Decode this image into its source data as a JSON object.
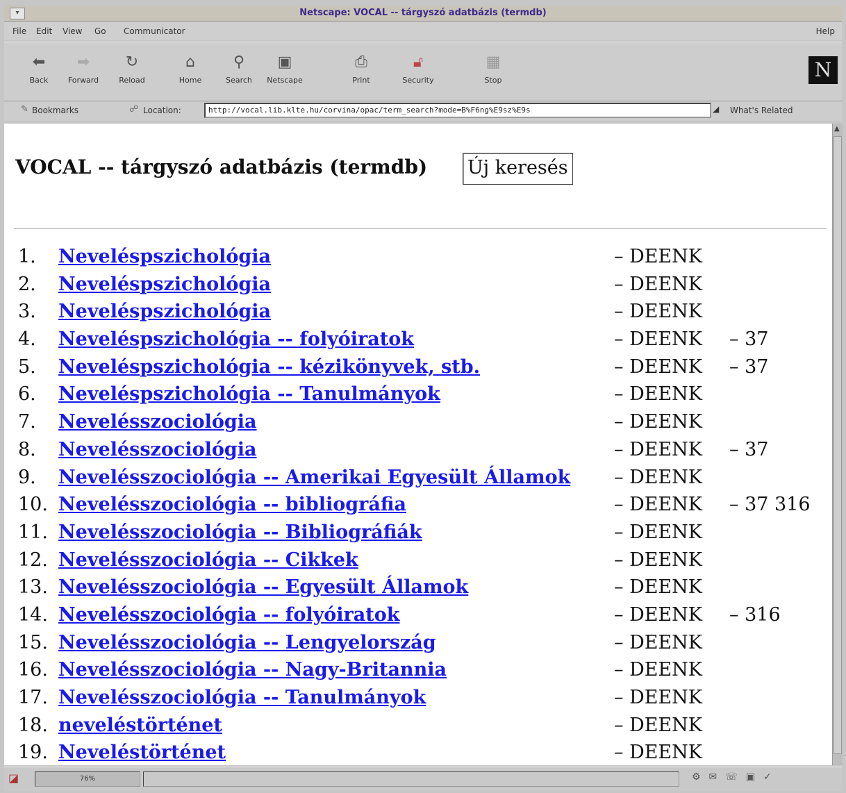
{
  "window": {
    "title": "Netscape: VOCAL -- tárgyszó adatbázis (termdb)"
  },
  "menu": {
    "items": [
      "File",
      "Edit",
      "View",
      "Go",
      "Communicator"
    ],
    "help": "Help"
  },
  "toolbar": {
    "buttons": [
      {
        "label": "Back",
        "icon": "back-arrow-icon"
      },
      {
        "label": "Forward",
        "icon": "forward-arrow-icon"
      },
      {
        "label": "Reload",
        "icon": "reload-icon"
      },
      {
        "label": "Home",
        "icon": "home-icon"
      },
      {
        "label": "Search",
        "icon": "search-icon"
      },
      {
        "label": "Netscape",
        "icon": "netscape-icon"
      },
      {
        "label": "Print",
        "icon": "print-icon"
      },
      {
        "label": "Security",
        "icon": "lock-icon"
      },
      {
        "label": "Stop",
        "icon": "stop-icon"
      }
    ],
    "logo": "N"
  },
  "location": {
    "bookmarks_label": "Bookmarks",
    "location_label": "Location:",
    "url": "http://vocal.lib.klte.hu/corvina/opac/term_search?mode=B%F6ng%E9sz%E9s",
    "related_label": "What's Related"
  },
  "page": {
    "title": "VOCAL -- tárgyszó adatbázis (termdb)",
    "new_search_button": "Új keresés"
  },
  "results": [
    {
      "num": "1.",
      "term": "Neveléspszichológia",
      "lib": "– DEENK",
      "code": ""
    },
    {
      "num": "2.",
      "term": "Neveléspszichológia",
      "lib": "– DEENK",
      "code": ""
    },
    {
      "num": "3.",
      "term": "Neveléspszichológia",
      "lib": "– DEENK",
      "code": ""
    },
    {
      "num": "4.",
      "term": "Neveléspszichológia -- folyóiratok",
      "lib": "– DEENK",
      "code": "– 37"
    },
    {
      "num": "5.",
      "term": "Neveléspszichológia -- kézikönyvek, stb.",
      "lib": "– DEENK",
      "code": "– 37"
    },
    {
      "num": "6.",
      "term": "Neveléspszichológia -- Tanulmányok",
      "lib": "– DEENK",
      "code": ""
    },
    {
      "num": "7.",
      "term": "Nevelésszociológia",
      "lib": "– DEENK",
      "code": ""
    },
    {
      "num": "8.",
      "term": "Nevelésszociológia",
      "lib": "– DEENK",
      "code": "– 37"
    },
    {
      "num": "9.",
      "term": "Nevelésszociológia -- Amerikai Egyesült Államok",
      "lib": "– DEENK",
      "code": ""
    },
    {
      "num": "10.",
      "term": "Nevelésszociológia -- bibliográfia",
      "lib": "– DEENK",
      "code": "– 37 316"
    },
    {
      "num": "11.",
      "term": "Nevelésszociológia -- Bibliográfiák",
      "lib": "– DEENK",
      "code": ""
    },
    {
      "num": "12.",
      "term": "Nevelésszociológia -- Cikkek",
      "lib": "– DEENK",
      "code": ""
    },
    {
      "num": "13.",
      "term": "Nevelésszociológia -- Egyesült Államok",
      "lib": "– DEENK",
      "code": ""
    },
    {
      "num": "14.",
      "term": "Nevelésszociológia -- folyóiratok",
      "lib": "– DEENK",
      "code": "– 316"
    },
    {
      "num": "15.",
      "term": "Nevelésszociológia -- Lengyelország",
      "lib": "– DEENK",
      "code": ""
    },
    {
      "num": "16.",
      "term": "Nevelésszociológia -- Nagy-Britannia",
      "lib": "– DEENK",
      "code": ""
    },
    {
      "num": "17.",
      "term": "Nevelésszociológia -- Tanulmányok",
      "lib": "– DEENK",
      "code": ""
    },
    {
      "num": "18.",
      "term": "neveléstörténet",
      "lib": "– DEENK",
      "code": ""
    },
    {
      "num": "19.",
      "term": "Neveléstörténet",
      "lib": "– DEENK",
      "code": ""
    }
  ],
  "status": {
    "progress": "76%"
  }
}
